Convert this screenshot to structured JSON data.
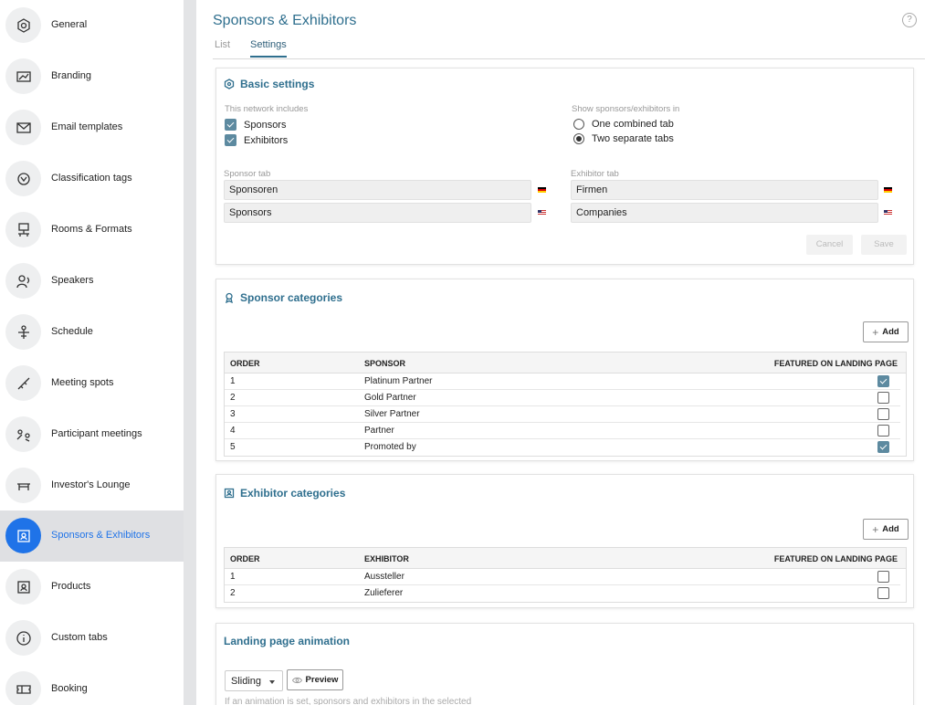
{
  "sidebar": {
    "items": [
      {
        "label": "General",
        "icon": "hexagon-gear-icon"
      },
      {
        "label": "Branding",
        "icon": "image-frame-icon"
      },
      {
        "label": "Email templates",
        "icon": "envelope-icon"
      },
      {
        "label": "Classification tags",
        "icon": "tags-globe-icon"
      },
      {
        "label": "Rooms & Formats",
        "icon": "presentation-room-icon"
      },
      {
        "label": "Speakers",
        "icon": "speaker-person-icon"
      },
      {
        "label": "Schedule",
        "icon": "schedule-person-icon"
      },
      {
        "label": "Meeting spots",
        "icon": "meeting-spots-icon"
      },
      {
        "label": "Participant meetings",
        "icon": "participant-meetings-icon"
      },
      {
        "label": "Investor's Lounge",
        "icon": "lounge-table-icon"
      },
      {
        "label": "Sponsors & Exhibitors",
        "icon": "sponsor-board-icon",
        "active": true
      },
      {
        "label": "Products",
        "icon": "products-board-icon"
      },
      {
        "label": "Custom tabs",
        "icon": "info-icon"
      },
      {
        "label": "Booking",
        "icon": "ticket-icon"
      }
    ]
  },
  "header": {
    "title": "Sponsors & Exhibitors",
    "help": "?"
  },
  "tabs": [
    "List",
    "Settings"
  ],
  "basic": {
    "title": "Basic settings",
    "includes_label": "This network includes",
    "sponsors_label": "Sponsors",
    "exhibitors_label": "Exhibitors",
    "sponsors_checked": true,
    "exhibitors_checked": true,
    "show_in_label": "Show sponsors/exhibitors in",
    "radio_one": "One combined tab",
    "radio_two": "Two separate tabs",
    "selected_radio": "Two separate tabs",
    "sponsor_tab_label": "Sponsor tab",
    "sponsor_de": "Sponsoren",
    "sponsor_en": "Sponsors",
    "exhibitor_tab_label": "Exhibitor tab",
    "exhibitor_de": "Firmen",
    "exhibitor_en": "Companies",
    "cancel": "Cancel",
    "save": "Save"
  },
  "sponsor_categories": {
    "title": "Sponsor categories",
    "add": "Add",
    "headers": [
      "ORDER",
      "SPONSOR",
      "FEATURED ON LANDING PAGE"
    ],
    "rows": [
      {
        "order": "1",
        "name": "Platinum Partner",
        "featured": true
      },
      {
        "order": "2",
        "name": "Gold Partner",
        "featured": false
      },
      {
        "order": "3",
        "name": "Silver Partner",
        "featured": false
      },
      {
        "order": "4",
        "name": "Partner",
        "featured": false
      },
      {
        "order": "5",
        "name": "Promoted by",
        "featured": true
      }
    ]
  },
  "exhibitor_categories": {
    "title": "Exhibitor categories",
    "add": "Add",
    "headers": [
      "ORDER",
      "EXHIBITOR",
      "FEATURED ON LANDING PAGE"
    ],
    "rows": [
      {
        "order": "1",
        "name": "Aussteller",
        "featured": false
      },
      {
        "order": "2",
        "name": "Zulieferer",
        "featured": false
      }
    ]
  },
  "animation": {
    "title": "Landing page animation",
    "select_value": "Sliding",
    "preview": "Preview",
    "note": "If an animation is set, sponsors and exhibitors in the selected"
  },
  "colors": {
    "accent": "#1f73e8",
    "title": "#2f6f8e",
    "checkbox": "#5d8aa0"
  }
}
